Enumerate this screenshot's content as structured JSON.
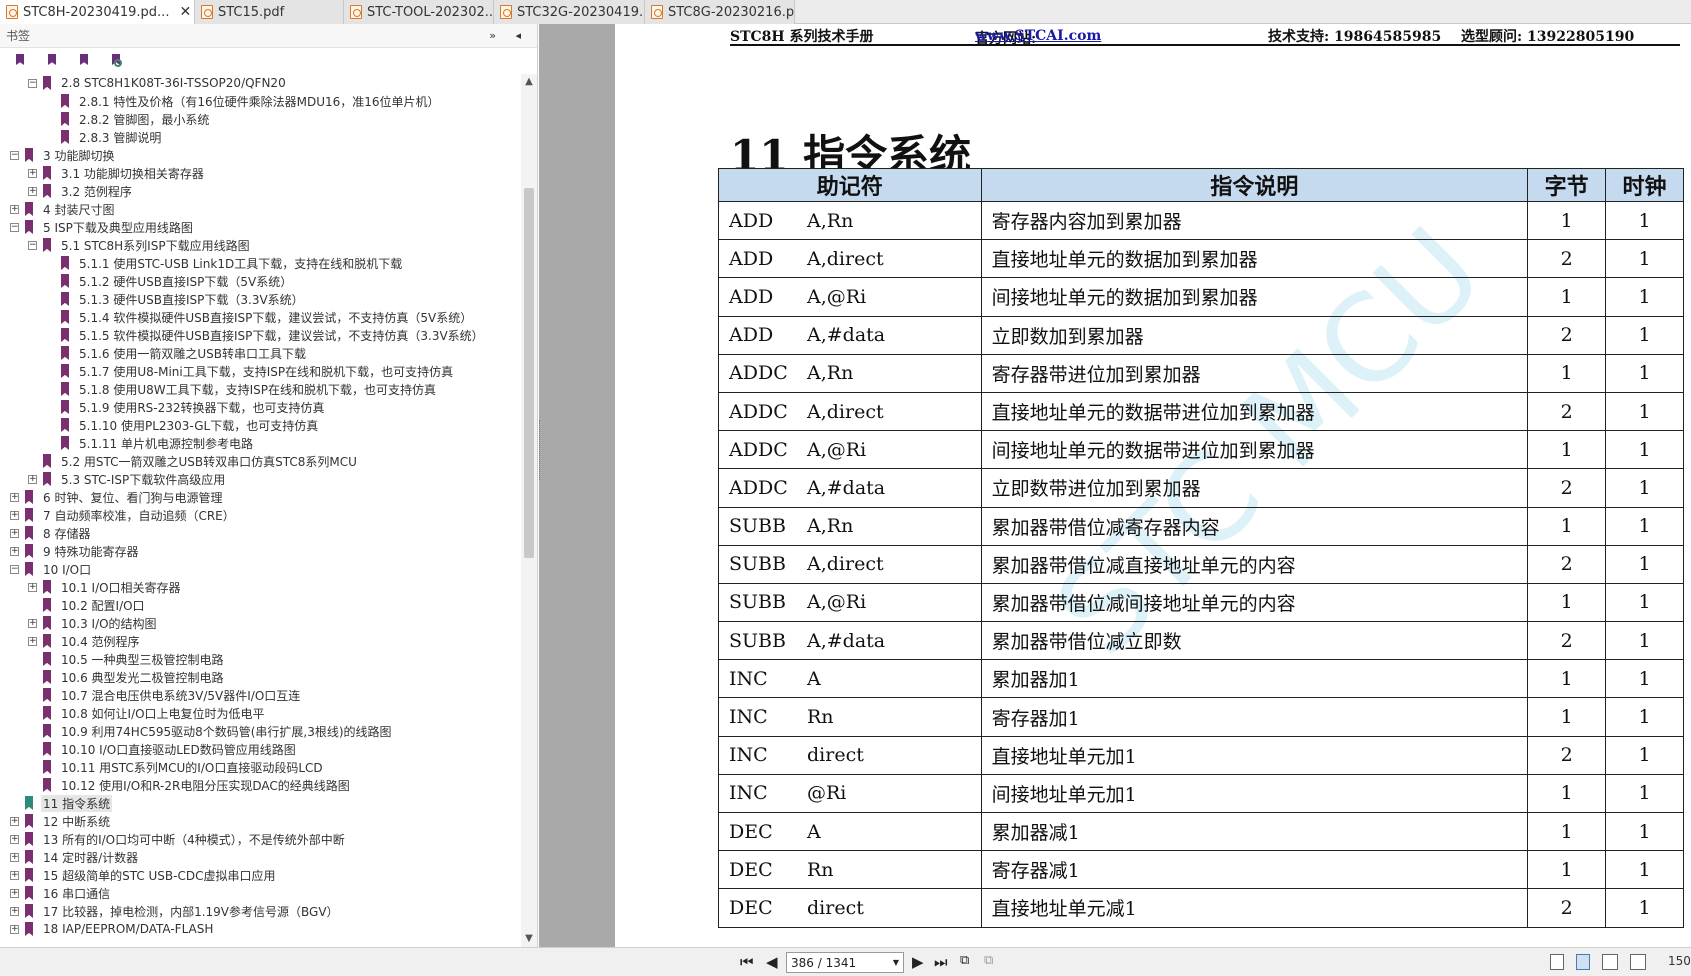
{
  "tabs": [
    {
      "label": "STC8H-20230419.pd...",
      "active": true,
      "closable": true
    },
    {
      "label": "STC15.pdf",
      "active": false
    },
    {
      "label": "STC-TOOL-202302...",
      "active": false
    },
    {
      "label": "STC32G-20230419...",
      "active": false
    },
    {
      "label": "STC8G-20230216.p...",
      "active": false
    }
  ],
  "sidebar": {
    "title": "书签",
    "controls": "» ◂",
    "toolbar_icons": [
      "bookmark-expand-icon",
      "bookmark-collapse-icon",
      "bookmark-add-icon",
      "bookmark-find-icon"
    ],
    "tree": [
      {
        "label": "2.8 STC8H1K08T-36I-TSSOP20/QFN20",
        "level": 1,
        "expander": "−"
      },
      {
        "label": "2.8.1 特性及价格（有16位硬件乘除法器MDU16，准16位单片机）",
        "level": 2,
        "expander": ""
      },
      {
        "label": "2.8.2 管脚图，最小系统",
        "level": 2,
        "expander": ""
      },
      {
        "label": "2.8.3 管脚说明",
        "level": 2,
        "expander": ""
      },
      {
        "label": "3 功能脚切换",
        "level": 0,
        "expander": "−"
      },
      {
        "label": "3.1 功能脚切换相关寄存器",
        "level": 1,
        "expander": "+"
      },
      {
        "label": "3.2 范例程序",
        "level": 1,
        "expander": "+"
      },
      {
        "label": "4 封装尺寸图",
        "level": 0,
        "expander": "+"
      },
      {
        "label": "5 ISP下载及典型应用线路图",
        "level": 0,
        "expander": "−"
      },
      {
        "label": "5.1 STC8H系列ISP下载应用线路图",
        "level": 1,
        "expander": "−"
      },
      {
        "label": "5.1.1 使用STC-USB Link1D工具下载，支持在线和脱机下载",
        "level": 2,
        "expander": ""
      },
      {
        "label": "5.1.2 硬件USB直接ISP下载（5V系统）",
        "level": 2,
        "expander": ""
      },
      {
        "label": "5.1.3 硬件USB直接ISP下载（3.3V系统）",
        "level": 2,
        "expander": ""
      },
      {
        "label": "5.1.4 软件模拟硬件USB直接ISP下载，建议尝试，不支持仿真（5V系统）",
        "level": 2,
        "expander": ""
      },
      {
        "label": "5.1.5 软件模拟硬件USB直接ISP下载，建议尝试，不支持仿真（3.3V系统）",
        "level": 2,
        "expander": ""
      },
      {
        "label": "5.1.6 使用一箭双雕之USB转串口工具下载",
        "level": 2,
        "expander": ""
      },
      {
        "label": "5.1.7 使用U8-Mini工具下载，支持ISP在线和脱机下载，也可支持仿真",
        "level": 2,
        "expander": ""
      },
      {
        "label": "5.1.8 使用U8W工具下载，支持ISP在线和脱机下载，也可支持仿真",
        "level": 2,
        "expander": ""
      },
      {
        "label": "5.1.9 使用RS-232转换器下载，也可支持仿真",
        "level": 2,
        "expander": ""
      },
      {
        "label": "5.1.10 使用PL2303-GL下载，也可支持仿真",
        "level": 2,
        "expander": ""
      },
      {
        "label": "5.1.11 单片机电源控制参考电路",
        "level": 2,
        "expander": ""
      },
      {
        "label": "5.2 用STC一箭双雕之USB转双串口仿真STC8系列MCU",
        "level": 1,
        "expander": ""
      },
      {
        "label": "5.3 STC-ISP下载软件高级应用",
        "level": 1,
        "expander": "+"
      },
      {
        "label": "6 时钟、复位、看门狗与电源管理",
        "level": 0,
        "expander": "+"
      },
      {
        "label": "7 自动频率校准，自动追频（CRE）",
        "level": 0,
        "expander": "+"
      },
      {
        "label": "8 存储器",
        "level": 0,
        "expander": "+"
      },
      {
        "label": "9 特殊功能寄存器",
        "level": 0,
        "expander": "+"
      },
      {
        "label": "10 I/O口",
        "level": 0,
        "expander": "−"
      },
      {
        "label": "10.1 I/O口相关寄存器",
        "level": 1,
        "expander": "+"
      },
      {
        "label": "10.2 配置I/O口",
        "level": 1,
        "expander": ""
      },
      {
        "label": "10.3 I/O的结构图",
        "level": 1,
        "expander": "+"
      },
      {
        "label": "10.4 范例程序",
        "level": 1,
        "expander": "+"
      },
      {
        "label": "10.5 一种典型三极管控制电路",
        "level": 1,
        "expander": ""
      },
      {
        "label": "10.6 典型发光二极管控制电路",
        "level": 1,
        "expander": ""
      },
      {
        "label": "10.7 混合电压供电系统3V/5V器件I/O口互连",
        "level": 1,
        "expander": ""
      },
      {
        "label": "10.8 如何让I/O口上电复位时为低电平",
        "level": 1,
        "expander": ""
      },
      {
        "label": "10.9 利用74HC595驱动8个数码管(串行扩展,3根线)的线路图",
        "level": 1,
        "expander": ""
      },
      {
        "label": "10.10 I/O口直接驱动LED数码管应用线路图",
        "level": 1,
        "expander": ""
      },
      {
        "label": "10.11 用STC系列MCU的I/O口直接驱动段码LCD",
        "level": 1,
        "expander": ""
      },
      {
        "label": "10.12 使用I/O和R-2R电阻分压实现DAC的经典线路图",
        "level": 1,
        "expander": ""
      },
      {
        "label": "11 指令系统",
        "level": 0,
        "expander": "",
        "selected": true
      },
      {
        "label": "12 中断系统",
        "level": 0,
        "expander": "+"
      },
      {
        "label": "13 所有的I/O口均可中断（4种模式），不是传统外部中断",
        "level": 0,
        "expander": "+"
      },
      {
        "label": "14 定时器/计数器",
        "level": 0,
        "expander": "+"
      },
      {
        "label": "15 超级简单的STC USB-CDC虚拟串口应用",
        "level": 0,
        "expander": "+"
      },
      {
        "label": "16 串口通信",
        "level": 0,
        "expander": "+"
      },
      {
        "label": "17 比较器，掉电检测，内部1.19V参考信号源（BGV）",
        "level": 0,
        "expander": "+"
      },
      {
        "label": "18 IAP/EEPROM/DATA-FLASH",
        "level": 0,
        "expander": "+"
      }
    ]
  },
  "document": {
    "header": {
      "manual": "STC8H 系列技术手册",
      "site_label": "官方网站: ",
      "site_url": "www.STCAI.com",
      "support": "技术支持: 19864585985",
      "sales": "选型顾问: 13922805190"
    },
    "chapter_title": "11  指令系统",
    "watermark": "STC MCU",
    "table": {
      "headers": [
        "助记符",
        "指令说明",
        "字节",
        "时钟"
      ],
      "rows": [
        {
          "op": "ADD",
          "arg": "A,Rn",
          "desc": "寄存器内容加到累加器",
          "bytes": "1",
          "clocks": "1"
        },
        {
          "op": "ADD",
          "arg": "A,direct",
          "desc": "直接地址单元的数据加到累加器",
          "bytes": "2",
          "clocks": "1"
        },
        {
          "op": "ADD",
          "arg": "A,@Ri",
          "desc": "间接地址单元的数据加到累加器",
          "bytes": "1",
          "clocks": "1"
        },
        {
          "op": "ADD",
          "arg": "A,#data",
          "desc": "立即数加到累加器",
          "bytes": "2",
          "clocks": "1"
        },
        {
          "op": "ADDC",
          "arg": "A,Rn",
          "desc": "寄存器带进位加到累加器",
          "bytes": "1",
          "clocks": "1"
        },
        {
          "op": "ADDC",
          "arg": "A,direct",
          "desc": "直接地址单元的数据带进位加到累加器",
          "bytes": "2",
          "clocks": "1"
        },
        {
          "op": "ADDC",
          "arg": "A,@Ri",
          "desc": "间接地址单元的数据带进位加到累加器",
          "bytes": "1",
          "clocks": "1"
        },
        {
          "op": "ADDC",
          "arg": "A,#data",
          "desc": "立即数带进位加到累加器",
          "bytes": "2",
          "clocks": "1"
        },
        {
          "op": "SUBB",
          "arg": "A,Rn",
          "desc": "累加器带借位减寄存器内容",
          "bytes": "1",
          "clocks": "1"
        },
        {
          "op": "SUBB",
          "arg": "A,direct",
          "desc": "累加器带借位减直接地址单元的内容",
          "bytes": "2",
          "clocks": "1"
        },
        {
          "op": "SUBB",
          "arg": "A,@Ri",
          "desc": "累加器带借位减间接地址单元的内容",
          "bytes": "1",
          "clocks": "1"
        },
        {
          "op": "SUBB",
          "arg": "A,#data",
          "desc": "累加器带借位减立即数",
          "bytes": "2",
          "clocks": "1"
        },
        {
          "op": "INC",
          "arg": "A",
          "desc": "累加器加1",
          "bytes": "1",
          "clocks": "1"
        },
        {
          "op": "INC",
          "arg": "Rn",
          "desc": "寄存器加1",
          "bytes": "1",
          "clocks": "1"
        },
        {
          "op": "INC",
          "arg": "direct",
          "desc": "直接地址单元加1",
          "bytes": "2",
          "clocks": "1"
        },
        {
          "op": "INC",
          "arg": "@Ri",
          "desc": "间接地址单元加1",
          "bytes": "1",
          "clocks": "1"
        },
        {
          "op": "DEC",
          "arg": "A",
          "desc": "累加器减1",
          "bytes": "1",
          "clocks": "1"
        },
        {
          "op": "DEC",
          "arg": "Rn",
          "desc": "寄存器减1",
          "bytes": "1",
          "clocks": "1"
        },
        {
          "op": "DEC",
          "arg": "direct",
          "desc": "直接地址单元减1",
          "bytes": "2",
          "clocks": "1"
        }
      ]
    }
  },
  "statusbar": {
    "page_value": "386 / 1341",
    "zoom": "150"
  },
  "colors": {
    "table_header_bg": "#c5d9ef",
    "bookmark": "#7a2f6e",
    "bookmark_selected": "#2e8b7a",
    "link": "#1a1aa6"
  }
}
